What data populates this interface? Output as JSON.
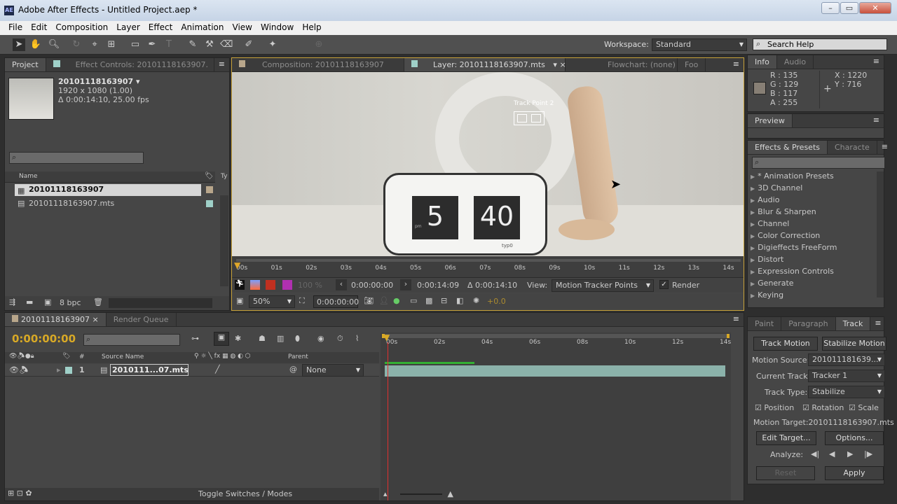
{
  "window": {
    "title": "Adobe After Effects - Untitled Project.aep *",
    "app_icon": "AE",
    "minimize": "–",
    "maximize": "▭",
    "close": "✕"
  },
  "menu": [
    "File",
    "Edit",
    "Composition",
    "Layer",
    "Effect",
    "Animation",
    "View",
    "Window",
    "Help"
  ],
  "toolbar": {
    "workspace_label": "Workspace:",
    "workspace_value": "Standard",
    "search_placeholder": "Search Help"
  },
  "project": {
    "tab": "Project",
    "effect_controls_tab": "Effect Controls: 20101118163907.",
    "item_name": "20101118163907 ▾",
    "item_size": "1920 x 1080 (1.00)",
    "item_duration": "Δ 0:00:14:10, 25.00 fps",
    "col_name": "Name",
    "col_type": "Ty",
    "items": [
      "20101118163907",
      "20101118163907.mts"
    ],
    "bpc": "8 bpc"
  },
  "viewer": {
    "tab_comp": "Composition: 20101118163907",
    "tab_layer": "Layer: 20101118163907.mts",
    "tab_flowchart": "Flowchart: (none)",
    "tab_footage": "Foo",
    "track_point_label": "Track Point 2",
    "clock_hour": "5",
    "clock_min": "40",
    "clock_pm": "pm",
    "clock_brand": "typ0",
    "ruler": [
      "00s",
      "01s",
      "02s",
      "03s",
      "04s",
      "05s",
      "06s",
      "07s",
      "08s",
      "09s",
      "10s",
      "11s",
      "12s",
      "13s",
      "14s"
    ],
    "opacity": "100 %",
    "in_point": "0:00:00:00",
    "out_point": "0:00:14:09",
    "duration": "Δ 0:00:14:10",
    "view_label": "View:",
    "view_value": "Motion Tracker Points",
    "render_label": "Render",
    "zoom": "50%",
    "current_time": "0:00:00:00",
    "exposure": "+0.0"
  },
  "info": {
    "tab": "Info",
    "audio_tab": "Audio",
    "r": "R : 135",
    "g": "G : 129",
    "b": "B : 117",
    "a": "A : 255",
    "x": "X : 1220",
    "y": "Y : 716",
    "swatch": "#877f75"
  },
  "preview": {
    "tab": "Preview"
  },
  "effects": {
    "tab": "Effects & Presets",
    "char_tab": "Characte",
    "items": [
      "* Animation Presets",
      "3D Channel",
      "Audio",
      "Blur & Sharpen",
      "Channel",
      "Color Correction",
      "Digieffects FreeForm",
      "Distort",
      "Expression Controls",
      "Generate",
      "Keying"
    ]
  },
  "timeline": {
    "tab": "20101118163907",
    "render_queue": "Render Queue",
    "timecode": "0:00:00:00",
    "col_num": "#",
    "col_source": "Source Name",
    "col_parent": "Parent",
    "layer_num": "1",
    "layer_name": "2010111...07.mts",
    "parent_value": "None",
    "toggle": "Toggle Switches / Modes",
    "ruler": [
      "00s",
      "02s",
      "04s",
      "06s",
      "08s",
      "10s",
      "12s",
      "14s"
    ]
  },
  "track": {
    "paint_tab": "Paint",
    "paragraph_tab": "Paragraph",
    "tab": "Track",
    "track_motion": "Track Motion",
    "stabilize_motion": "Stabilize Motion",
    "motion_source_label": "Motion Source:",
    "motion_source": "201011181639...",
    "current_track_label": "Current Track:",
    "current_track": "Tracker 1",
    "track_type_label": "Track Type:",
    "track_type": "Stabilize",
    "position": "Position",
    "rotation": "Rotation",
    "scale": "Scale",
    "motion_target": "Motion Target:20101118163907.mts",
    "edit_target": "Edit Target...",
    "options": "Options...",
    "analyze": "Analyze:",
    "reset": "Reset",
    "apply": "Apply"
  }
}
